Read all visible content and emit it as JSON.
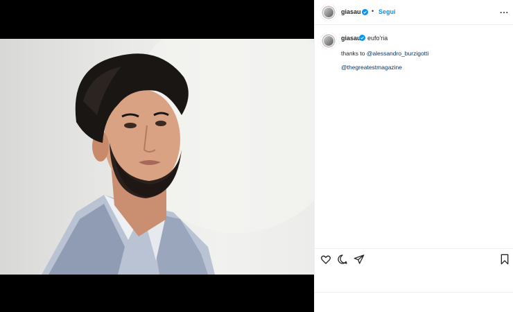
{
  "post": {
    "author": "giasau",
    "follow_label": "Segui",
    "separator": "•",
    "more_label": "..."
  },
  "caption": {
    "author": "giasau",
    "text": "eufo'ria",
    "thanks_prefix": "thanks to ",
    "mention1": "@alessandro_burzigotti",
    "mention2": "@thegreatestmagazine"
  },
  "actions": [
    "like",
    "comment",
    "share",
    "save"
  ],
  "icons": {
    "verified_color": "#0095f6",
    "like": "heart-icon",
    "comment": "comment-icon",
    "share": "send-icon",
    "save": "bookmark-icon"
  }
}
